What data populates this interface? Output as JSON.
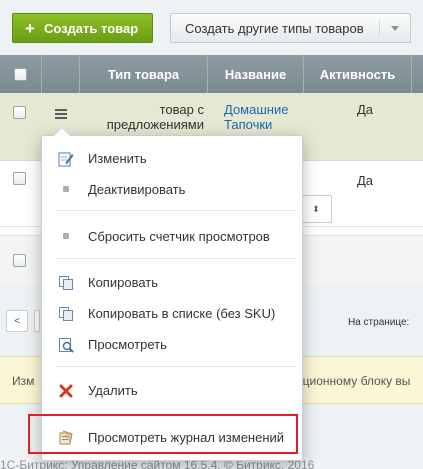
{
  "toolbar": {
    "create_label": "Создать товар",
    "create_icon": "plus-icon",
    "other_types_label": "Создать другие типы товаров"
  },
  "table": {
    "headers": [
      "Тип товара",
      "Название",
      "Активность"
    ],
    "rows": [
      {
        "type": "товар с предложениями",
        "name": "Домашние Тапочки",
        "active": "Да"
      },
      {
        "type": "",
        "name": "",
        "active": "Да"
      }
    ]
  },
  "pager": {
    "prev_label": "<",
    "per_page_label": "На странице:"
  },
  "notice": {
    "left_text": "Изм",
    "right_text": "ационному блоку вы"
  },
  "footer": {
    "text": "1С-Битрикс: Управление сайтом 16.5.4. © Битрикс, 2016"
  },
  "menu": {
    "items": [
      {
        "label": "Изменить",
        "icon": "edit-icon"
      },
      {
        "label": "Деактивировать",
        "icon": "dot-icon"
      },
      {
        "label": "Сбросить счетчик просмотров",
        "icon": "dot-icon"
      },
      {
        "label": "Копировать",
        "icon": "copy-icon"
      },
      {
        "label": "Копировать в списке (без SKU)",
        "icon": "copy-icon"
      },
      {
        "label": "Просмотреть",
        "icon": "preview-icon"
      },
      {
        "label": "Удалить",
        "icon": "delete-icon"
      },
      {
        "label": "Просмотреть журнал изменений",
        "icon": "history-log-icon"
      }
    ]
  },
  "colors": {
    "create_button": "#7bb21c",
    "highlight_border": "#e01e25",
    "selected_row": "#e5e8d2",
    "link": "#2067b0"
  }
}
